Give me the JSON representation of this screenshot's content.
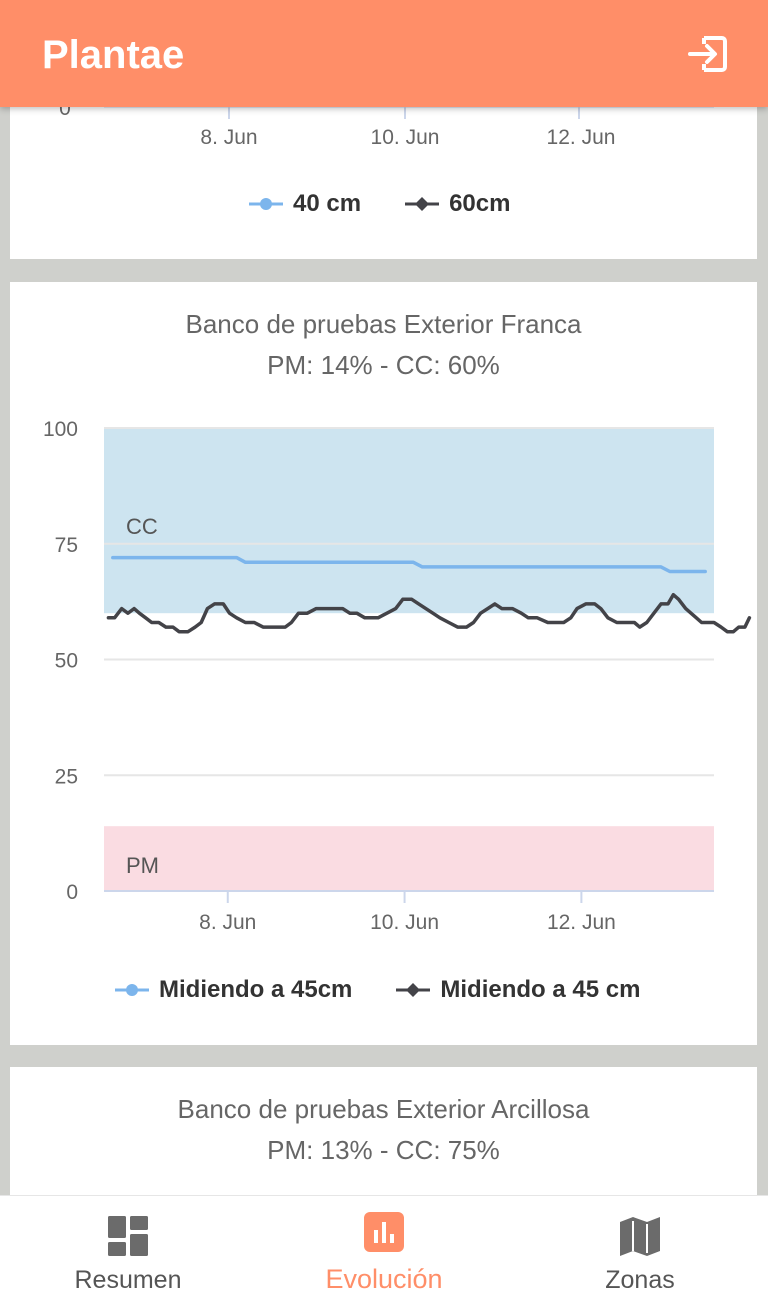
{
  "app": {
    "title": "Plantae"
  },
  "top_chart": {
    "partial_y_tick": "0",
    "x_ticks": [
      "8. Jun",
      "10. Jun",
      "12. Jun"
    ],
    "legend": [
      "40 cm",
      "60cm"
    ]
  },
  "franca": {
    "title": "Banco de pruebas Exterior Franca",
    "subtitle": "PM: 14% - CC: 60%",
    "band_labels": {
      "cc": "CC",
      "pm": "PM"
    },
    "legend": [
      "Midiendo a 45cm",
      "Midiendo a 45 cm"
    ]
  },
  "arcillosa": {
    "title": "Banco de pruebas Exterior Arcillosa",
    "subtitle": "PM: 13% - CC: 75%"
  },
  "nav": {
    "items": [
      {
        "label": "Resumen",
        "icon": "dashboard-icon",
        "active": false
      },
      {
        "label": "Evolución",
        "icon": "bar-chart-icon",
        "active": true
      },
      {
        "label": "Zonas",
        "icon": "map-icon",
        "active": false
      }
    ]
  },
  "colors": {
    "appbar": "#ff8e68",
    "cc_band": "#cde4f0",
    "pm_band": "#fadce2",
    "series_light": "#7cb5ec",
    "series_dark": "#434348"
  },
  "chart_data": {
    "type": "line",
    "title": "Banco de pruebas Exterior Franca",
    "subtitle": "PM: 14% - CC: 60%",
    "xlabel": "",
    "ylabel": "",
    "ylim": [
      0,
      100
    ],
    "xlim": [
      6.6,
      13.5
    ],
    "x_unit": "day of June",
    "x_ticks": [
      "8. Jun",
      "10. Jun",
      "12. Jun"
    ],
    "y_ticks": [
      0,
      25,
      50,
      75,
      100
    ],
    "grid": true,
    "legend_position": "bottom",
    "plot_bands": [
      {
        "label": "CC",
        "from": 60,
        "to": 100,
        "color": "#cde4f0"
      },
      {
        "label": "PM",
        "from": 0,
        "to": 14,
        "color": "#fadce2"
      }
    ],
    "series": [
      {
        "name": "Midiendo a 45cm",
        "color": "#7cb5ec",
        "marker": "circle",
        "points": [
          [
            6.7,
            72
          ],
          [
            8.1,
            72
          ],
          [
            8.2,
            71
          ],
          [
            10.1,
            71
          ],
          [
            10.2,
            70
          ],
          [
            12.9,
            70
          ],
          [
            13.0,
            69
          ],
          [
            13.4,
            69
          ]
        ]
      },
      {
        "name": "Midiendo a 45 cm",
        "color": "#434348",
        "marker": "diamond",
        "points": [
          [
            6.65,
            59
          ],
          [
            6.72,
            59
          ],
          [
            6.8,
            61
          ],
          [
            6.87,
            60
          ],
          [
            6.94,
            61
          ],
          [
            7.0,
            60
          ],
          [
            7.07,
            59
          ],
          [
            7.14,
            58
          ],
          [
            7.22,
            58
          ],
          [
            7.3,
            57
          ],
          [
            7.38,
            57
          ],
          [
            7.45,
            56
          ],
          [
            7.55,
            56
          ],
          [
            7.63,
            57
          ],
          [
            7.7,
            58
          ],
          [
            7.77,
            61
          ],
          [
            7.85,
            62
          ],
          [
            7.95,
            62
          ],
          [
            8.02,
            60
          ],
          [
            8.1,
            59
          ],
          [
            8.2,
            58
          ],
          [
            8.3,
            58
          ],
          [
            8.4,
            57
          ],
          [
            8.55,
            57
          ],
          [
            8.65,
            57
          ],
          [
            8.72,
            58
          ],
          [
            8.8,
            60
          ],
          [
            8.9,
            60
          ],
          [
            9.0,
            61
          ],
          [
            9.15,
            61
          ],
          [
            9.3,
            61
          ],
          [
            9.38,
            60
          ],
          [
            9.46,
            60
          ],
          [
            9.55,
            59
          ],
          [
            9.7,
            59
          ],
          [
            9.8,
            60
          ],
          [
            9.9,
            61
          ],
          [
            9.98,
            63
          ],
          [
            10.08,
            63
          ],
          [
            10.16,
            62
          ],
          [
            10.24,
            61
          ],
          [
            10.32,
            60
          ],
          [
            10.4,
            59
          ],
          [
            10.5,
            58
          ],
          [
            10.6,
            57
          ],
          [
            10.7,
            57
          ],
          [
            10.78,
            58
          ],
          [
            10.86,
            60
          ],
          [
            10.94,
            61
          ],
          [
            11.02,
            62
          ],
          [
            11.1,
            61
          ],
          [
            11.22,
            61
          ],
          [
            11.32,
            60
          ],
          [
            11.4,
            59
          ],
          [
            11.5,
            59
          ],
          [
            11.62,
            58
          ],
          [
            11.72,
            58
          ],
          [
            11.8,
            58
          ],
          [
            11.88,
            59
          ],
          [
            11.95,
            61
          ],
          [
            12.05,
            62
          ],
          [
            12.15,
            62
          ],
          [
            12.22,
            61
          ],
          [
            12.3,
            59
          ],
          [
            12.4,
            58
          ],
          [
            12.5,
            58
          ],
          [
            12.6,
            58
          ],
          [
            12.66,
            57
          ],
          [
            12.74,
            58
          ],
          [
            12.82,
            60
          ],
          [
            12.9,
            62
          ],
          [
            12.98,
            62
          ],
          [
            13.04,
            64
          ],
          [
            13.1,
            63
          ],
          [
            13.18,
            61
          ],
          [
            13.24,
            60
          ],
          [
            13.3,
            59
          ],
          [
            13.36,
            58
          ],
          [
            13.42,
            58
          ],
          [
            13.5,
            58
          ],
          [
            13.58,
            57
          ],
          [
            13.65,
            56
          ],
          [
            13.72,
            56
          ],
          [
            13.78,
            57
          ],
          [
            13.85,
            57
          ],
          [
            13.9,
            59
          ]
        ]
      }
    ]
  }
}
